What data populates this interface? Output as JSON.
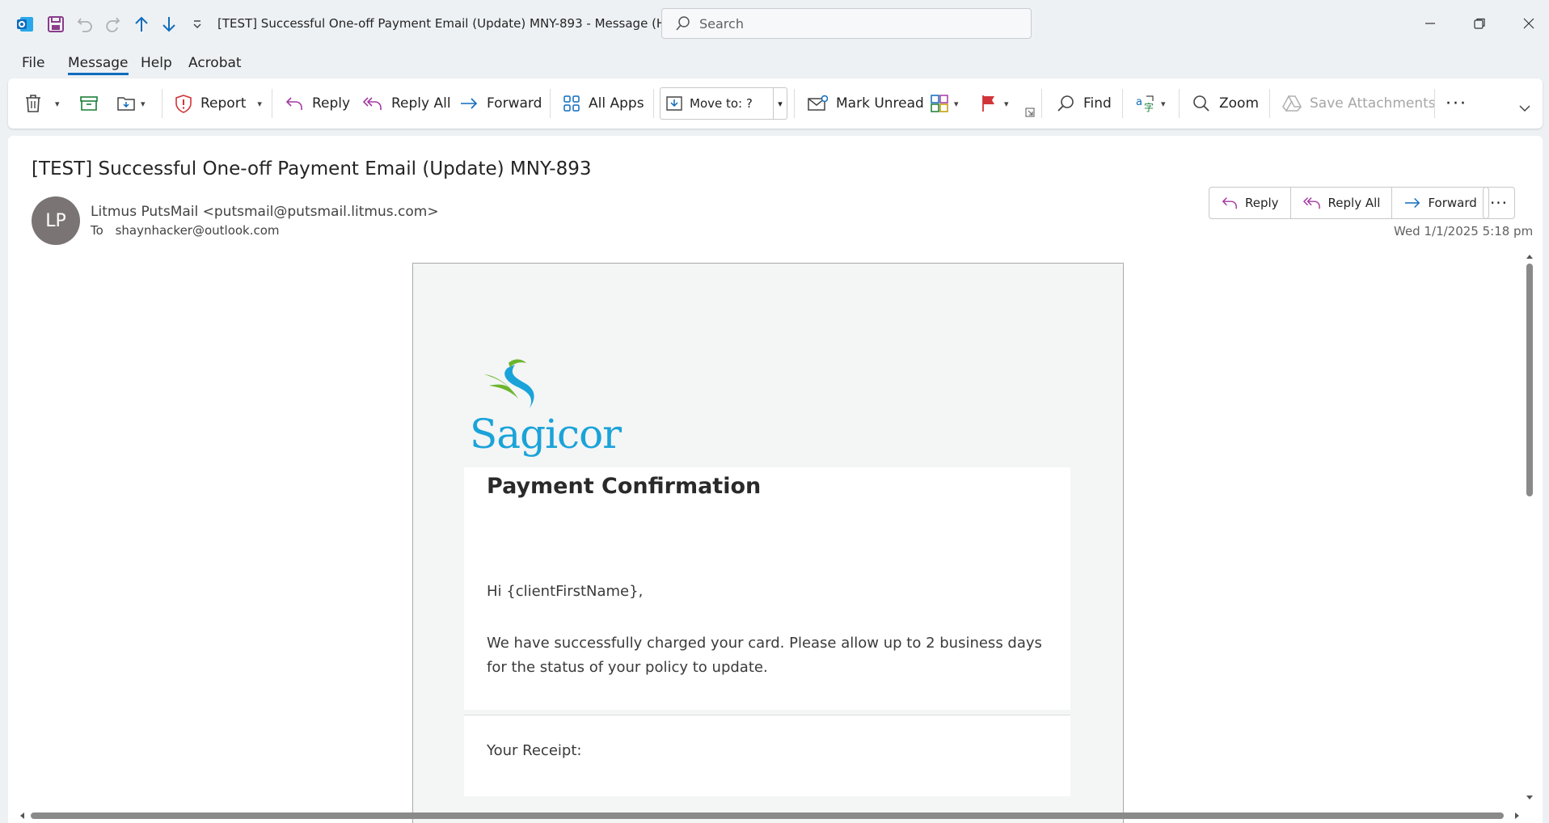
{
  "window": {
    "title": "[TEST] Successful One-off Payment Email (Update) MNY-893  -  Message (HT...",
    "search_placeholder": "Search"
  },
  "menu": {
    "tabs": [
      "File",
      "Message",
      "Help",
      "Acrobat"
    ],
    "active": "Message"
  },
  "ribbon": {
    "report": "Report",
    "reply": "Reply",
    "reply_all": "Reply All",
    "forward": "Forward",
    "all_apps": "All Apps",
    "move_to": "Move to: ?",
    "mark_unread": "Mark Unread",
    "find": "Find",
    "zoom": "Zoom",
    "save_attachments": "Save Attachments"
  },
  "message": {
    "subject": "[TEST] Successful One-off Payment Email (Update) MNY-893",
    "avatar_initials": "LP",
    "sender": "Litmus PutsMail <putsmail@putsmail.litmus.com>",
    "to_label": "To",
    "to": "shaynhacker@outlook.com",
    "date": "Wed 1/1/2025 5:18 pm",
    "actions": {
      "reply": "Reply",
      "reply_all": "Reply All",
      "forward": "Forward"
    }
  },
  "email": {
    "logo_text": "Sagicor",
    "heading": "Payment Confirmation",
    "greeting": "Hi {clientFirstName},",
    "body": "We have successfully charged your card. Please allow up to 2 business days for the status of your policy to update.",
    "receipt_label": "Your Receipt:"
  },
  "colors": {
    "accent": "#0f6cbd",
    "reply_purple": "#a33aa3",
    "sagicor_blue": "#1aa3d9",
    "sagicor_green": "#6cb52d"
  }
}
